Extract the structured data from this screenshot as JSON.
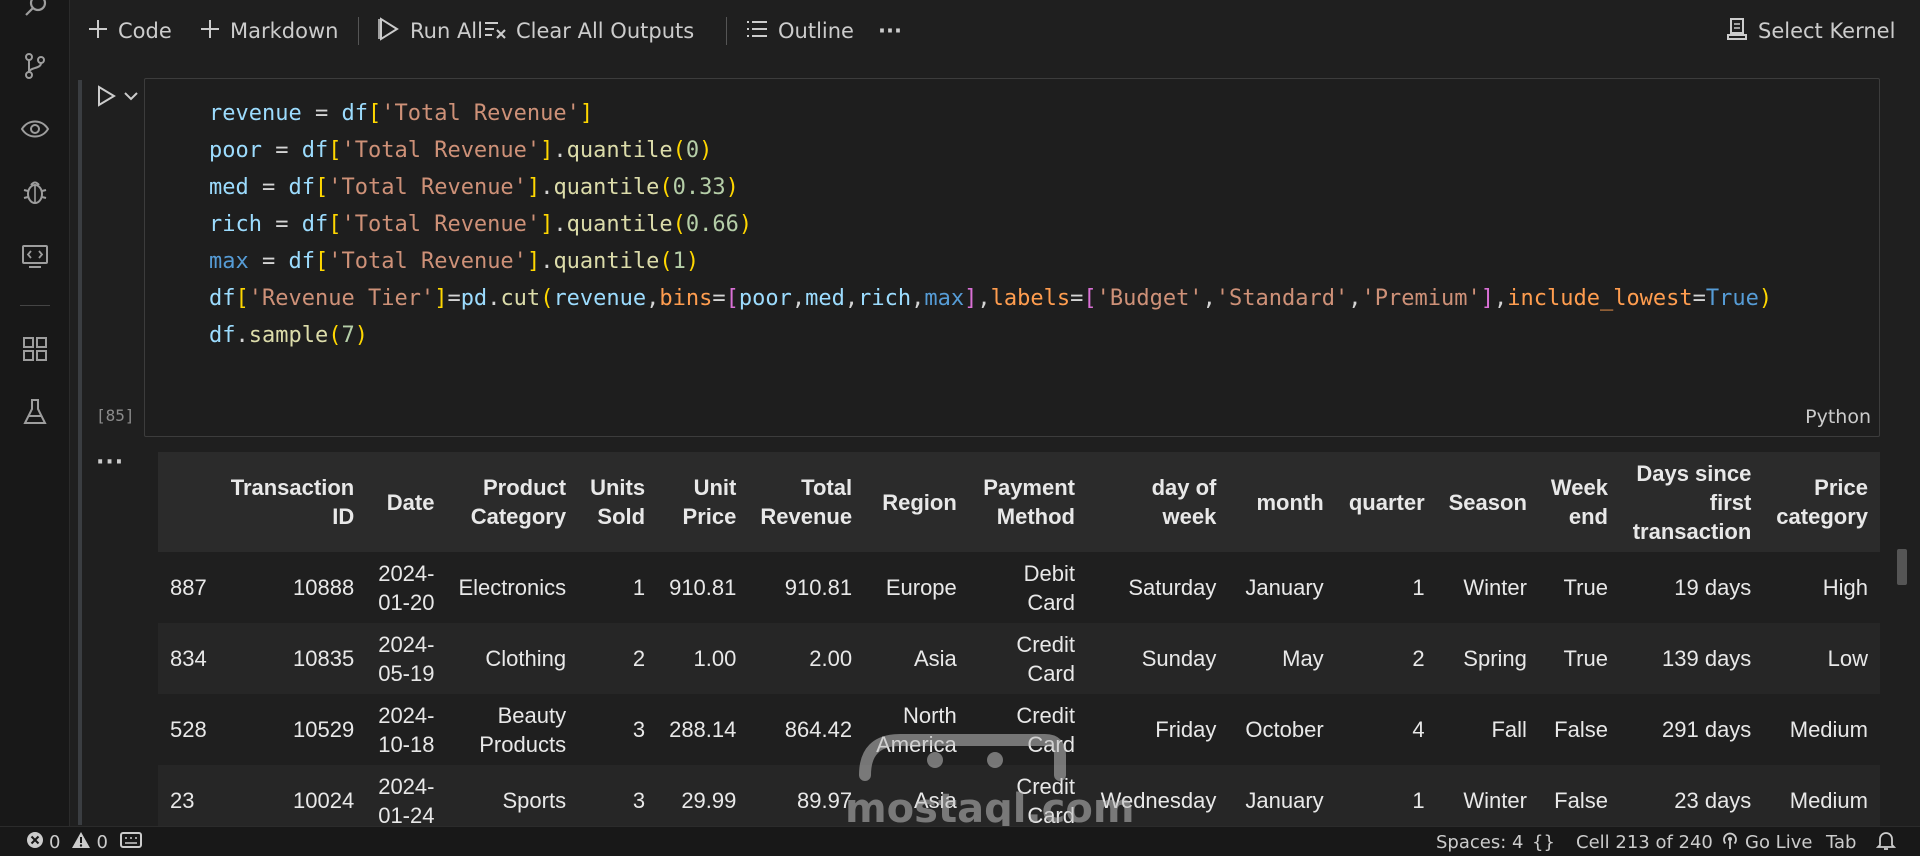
{
  "toolbar": {
    "code_label": "Code",
    "markdown_label": "Markdown",
    "run_all_label": "Run All",
    "clear_outputs_label": "Clear All Outputs",
    "outline_label": "Outline",
    "more_label": "···",
    "select_kernel_label": "Select Kernel"
  },
  "cell": {
    "execution_count": "[85]",
    "language": "Python"
  },
  "output": {
    "dots": "···",
    "columns": [
      "",
      "Transaction ID",
      "Date",
      "Product Category",
      "Units Sold",
      "Unit Price",
      "Total Revenue",
      "Region",
      "Payment Method",
      "day of week",
      "month",
      "quarter",
      "Season",
      "Week end",
      "Days since first transaction",
      "Price category"
    ],
    "rows": [
      [
        "887",
        "10888",
        "2024-01-20",
        "Electronics",
        "1",
        "910.81",
        "910.81",
        "Europe",
        "Debit Card",
        "Saturday",
        "January",
        "1",
        "Winter",
        "True",
        "19 days",
        "High"
      ],
      [
        "834",
        "10835",
        "2024-05-19",
        "Clothing",
        "2",
        "1.00",
        "2.00",
        "Asia",
        "Credit Card",
        "Sunday",
        "May",
        "2",
        "Spring",
        "True",
        "139 days",
        "Low"
      ],
      [
        "528",
        "10529",
        "2024-10-18",
        "Beauty Products",
        "3",
        "288.14",
        "864.42",
        "North America",
        "Credit Card",
        "Friday",
        "October",
        "4",
        "Fall",
        "False",
        "291 days",
        "Medium"
      ],
      [
        "23",
        "10024",
        "2024-01-24",
        "Sports",
        "3",
        "29.99",
        "89.97",
        "Asia",
        "Credit Card",
        "Wednesday",
        "January",
        "1",
        "Winter",
        "False",
        "23 days",
        "Medium"
      ]
    ]
  },
  "watermark": {
    "text": "mostaql.com"
  },
  "status": {
    "errors": "0",
    "warnings": "0",
    "spaces": "Spaces: 4",
    "braces": "{}",
    "cell_position": "Cell 213 of 240",
    "go_live": "Go Live",
    "tab": "Tab"
  },
  "icons": {
    "activity": [
      "search-icon",
      "source-control-icon",
      "eye-icon",
      "debug-icon",
      "remote-explorer-icon",
      "extensions-icon",
      "testing-icon"
    ]
  },
  "colors": {
    "background": "#1f1f1f",
    "editor": "#1e1e1e",
    "header_row": "#2b2b2b"
  }
}
